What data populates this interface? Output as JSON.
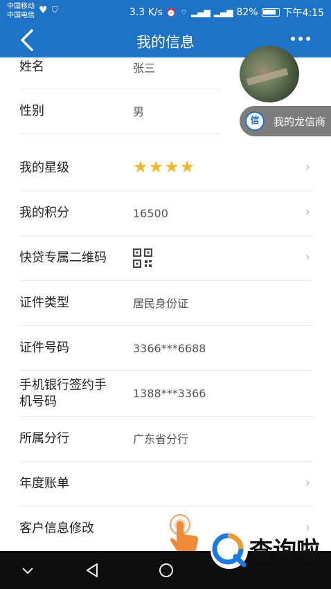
{
  "status_bar": {
    "carrier1": "中国移动",
    "carrier2": "中国电信",
    "speed": "3.3 K/s",
    "battery": "82%",
    "time": "下午4:15"
  },
  "nav": {
    "title": "我的信息"
  },
  "rows": [
    {
      "label": "姓名",
      "value": "张三"
    },
    {
      "label": "性别",
      "value": "男"
    },
    {
      "label": "我的星级",
      "stars": 4
    },
    {
      "label": "我的积分",
      "value": "16500"
    },
    {
      "label": "快贷专属二维码"
    },
    {
      "label": "证件类型",
      "value": "居民身份证"
    },
    {
      "label": "证件号码",
      "value": "3366***6688"
    },
    {
      "label": "手机银行签约手机号码",
      "value": "1388***3366"
    },
    {
      "label": "所属分行",
      "value": "广东省分行"
    },
    {
      "label": "年度账单"
    },
    {
      "label": "客户信息修改"
    }
  ],
  "float_button": {
    "label": "我的龙信商",
    "logo": "信"
  },
  "watermark": {
    "text": "查询啦",
    "url": "chaxunla.com"
  },
  "icons": {
    "back": "chevron-left-icon",
    "more": "more-icon",
    "chevron": "chevron-right-icon",
    "qr": "qr-code-icon"
  },
  "colors": {
    "primary": "#1f73c7",
    "star": "#f5b828"
  }
}
